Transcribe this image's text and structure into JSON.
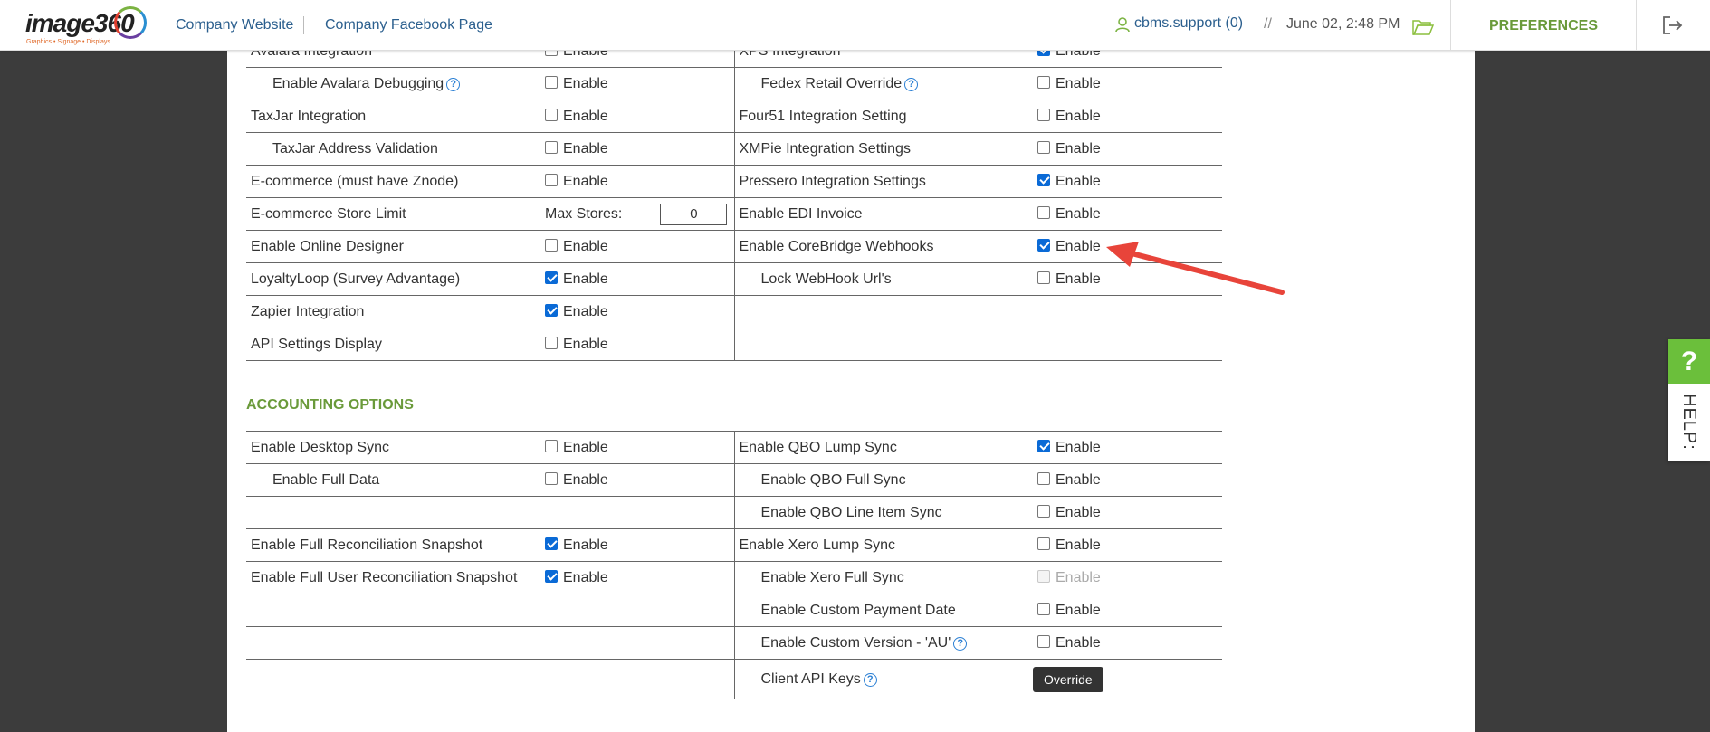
{
  "header": {
    "logo_text": "image360",
    "logo_tagline": "Graphics • Signage • Displays",
    "links": [
      "Company Website",
      "Company Facebook Page"
    ],
    "user": "cbms.support (0)",
    "separator": "//",
    "datetime": "June 02, 2:48 PM",
    "preferences": "PREFERENCES"
  },
  "integration_rows": [
    {
      "left": "Avalara Integration",
      "left_indent": false,
      "left_help": false,
      "left_checked": false,
      "right": "XPS Integration",
      "right_indent": false,
      "right_help": false,
      "right_checked": true
    },
    {
      "left": "Enable Avalara Debugging",
      "left_indent": true,
      "left_help": true,
      "left_checked": false,
      "right": "Fedex Retail Override",
      "right_indent": true,
      "right_help": true,
      "right_checked": false
    },
    {
      "left": "TaxJar Integration",
      "left_indent": false,
      "left_help": false,
      "left_checked": false,
      "right": "Four51 Integration Setting",
      "right_indent": false,
      "right_help": false,
      "right_checked": false
    },
    {
      "left": "TaxJar Address Validation",
      "left_indent": true,
      "left_help": false,
      "left_checked": false,
      "right": "XMPie Integration Settings",
      "right_indent": false,
      "right_help": false,
      "right_checked": false
    },
    {
      "left": "E-commerce (must have Znode)",
      "left_indent": false,
      "left_help": false,
      "left_checked": false,
      "right": "Pressero Integration Settings",
      "right_indent": false,
      "right_help": false,
      "right_checked": true
    },
    {
      "left": "E-commerce Store Limit",
      "left_indent": false,
      "left_help": false,
      "left_maxstores": true,
      "right": "Enable EDI Invoice",
      "right_indent": false,
      "right_help": false,
      "right_checked": false
    },
    {
      "left": "Enable Online Designer",
      "left_indent": false,
      "left_help": false,
      "left_checked": false,
      "right": "Enable CoreBridge Webhooks",
      "right_indent": false,
      "right_help": false,
      "right_checked": true
    },
    {
      "left": "LoyaltyLoop (Survey Advantage)",
      "left_indent": false,
      "left_help": false,
      "left_checked": true,
      "right": "Lock WebHook Url's",
      "right_indent": true,
      "right_help": false,
      "right_checked": false
    },
    {
      "left": "Zapier Integration",
      "left_indent": false,
      "left_help": false,
      "left_checked": true,
      "right": "",
      "right_empty": true
    },
    {
      "left": "API Settings Display",
      "left_indent": false,
      "left_help": false,
      "left_checked": false,
      "right": "",
      "right_empty": true
    }
  ],
  "enable_label": "Enable",
  "max_stores_label": "Max Stores:",
  "max_stores_value": "0",
  "accounting_title": "ACCOUNTING OPTIONS",
  "accounting_rows": [
    {
      "left": "Enable Desktop Sync",
      "left_indent": false,
      "left_checked": false,
      "right": "Enable QBO Lump Sync",
      "right_indent": false,
      "right_checked": true
    },
    {
      "left": "Enable Full Data",
      "left_indent": true,
      "left_checked": false,
      "right": "Enable QBO Full Sync",
      "right_indent": true,
      "right_checked": false
    },
    {
      "left": "",
      "left_empty": true,
      "right": "Enable QBO Line Item Sync",
      "right_indent": true,
      "right_checked": false
    },
    {
      "left": "Enable Full Reconciliation Snapshot",
      "left_indent": false,
      "left_checked": true,
      "right": "Enable Xero Lump Sync",
      "right_indent": false,
      "right_checked": false
    },
    {
      "left": "Enable Full User Reconciliation Snapshot",
      "left_indent": false,
      "left_checked": true,
      "right": "Enable Xero Full Sync",
      "right_indent": true,
      "right_checked": false,
      "right_disabled": true
    },
    {
      "left": "",
      "left_empty": true,
      "right": "Enable Custom Payment Date",
      "right_indent": true,
      "right_checked": false
    },
    {
      "left": "",
      "left_empty": true,
      "right": "Enable Custom Version - 'AU'",
      "right_indent": true,
      "right_help": true,
      "right_checked": false
    },
    {
      "left": "",
      "left_empty": true,
      "right": "Client API Keys",
      "right_indent": true,
      "right_help": true,
      "right_button": "Override"
    }
  ],
  "help_tab": {
    "q": "?",
    "label": "HELP:"
  },
  "colors": {
    "accent_green": "#6a9a3a",
    "link_blue": "#2b5f8e",
    "checkbox_blue": "#0a6ad6",
    "arrow_red": "#e8443a",
    "help_green": "#6bbf3b"
  },
  "icons": [
    "user-icon",
    "folder-icon",
    "logout-icon",
    "help-circle-icon",
    "annotation-arrow"
  ]
}
